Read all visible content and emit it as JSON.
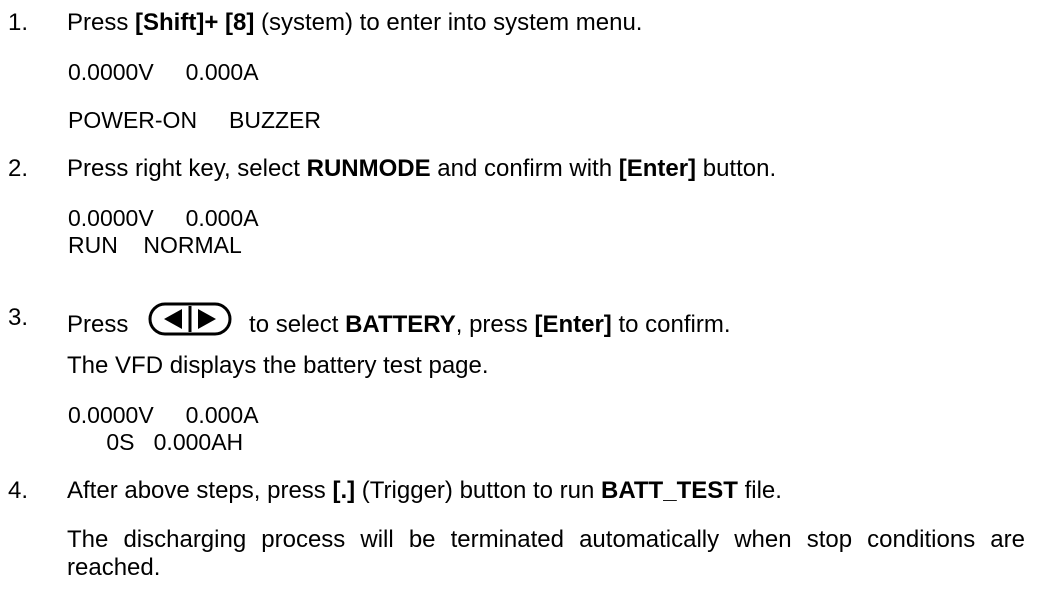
{
  "steps": [
    {
      "number": "1.",
      "parts": [
        "Press ",
        "[Shift]+ [8]",
        " (system) to enter into system menu."
      ],
      "display_lines": [
        "0.0000V     0.000A",
        "POWER-ON     BUZZER"
      ]
    },
    {
      "number": "2.",
      "parts": [
        "Press right key, select ",
        "RUNMODE",
        " and confirm with ",
        "[Enter]",
        " button."
      ],
      "display_lines": [
        "0.0000V     0.000A",
        "RUN    NORMAL"
      ]
    },
    {
      "number": "3.",
      "parts": [
        "Press",
        " to select ",
        "BATTERY",
        ", press ",
        "[Enter]",
        " to confirm."
      ],
      "icon": "left-right-arrow-keys-icon",
      "note": "The VFD displays the battery test page.",
      "display_lines": [
        "0.0000V     0.000A",
        "      0S   0.000AH"
      ]
    },
    {
      "number": "4.",
      "parts": [
        "After above steps, press ",
        "[.]",
        " (Trigger) button to run ",
        "BATT_TEST",
        " file."
      ],
      "note": "The discharging process will be terminated automatically when stop conditions are reached."
    }
  ]
}
